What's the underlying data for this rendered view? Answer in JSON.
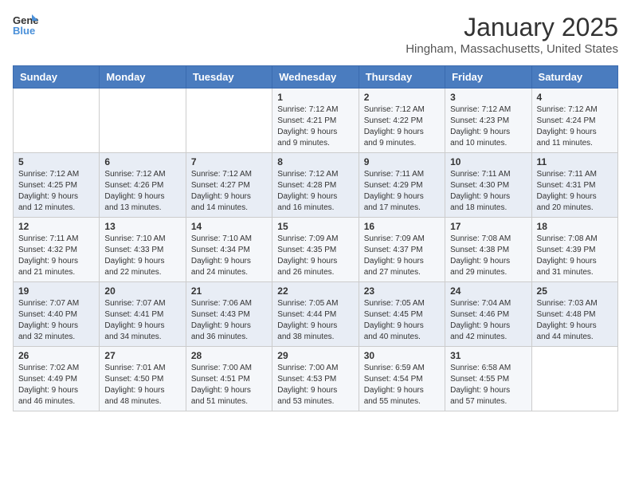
{
  "logo": {
    "general": "General",
    "blue": "Blue"
  },
  "header": {
    "month": "January 2025",
    "location": "Hingham, Massachusetts, United States"
  },
  "weekdays": [
    "Sunday",
    "Monday",
    "Tuesday",
    "Wednesday",
    "Thursday",
    "Friday",
    "Saturday"
  ],
  "weeks": [
    [
      {
        "day": "",
        "info": ""
      },
      {
        "day": "",
        "info": ""
      },
      {
        "day": "",
        "info": ""
      },
      {
        "day": "1",
        "info": "Sunrise: 7:12 AM\nSunset: 4:21 PM\nDaylight: 9 hours\nand 9 minutes."
      },
      {
        "day": "2",
        "info": "Sunrise: 7:12 AM\nSunset: 4:22 PM\nDaylight: 9 hours\nand 9 minutes."
      },
      {
        "day": "3",
        "info": "Sunrise: 7:12 AM\nSunset: 4:23 PM\nDaylight: 9 hours\nand 10 minutes."
      },
      {
        "day": "4",
        "info": "Sunrise: 7:12 AM\nSunset: 4:24 PM\nDaylight: 9 hours\nand 11 minutes."
      }
    ],
    [
      {
        "day": "5",
        "info": "Sunrise: 7:12 AM\nSunset: 4:25 PM\nDaylight: 9 hours\nand 12 minutes."
      },
      {
        "day": "6",
        "info": "Sunrise: 7:12 AM\nSunset: 4:26 PM\nDaylight: 9 hours\nand 13 minutes."
      },
      {
        "day": "7",
        "info": "Sunrise: 7:12 AM\nSunset: 4:27 PM\nDaylight: 9 hours\nand 14 minutes."
      },
      {
        "day": "8",
        "info": "Sunrise: 7:12 AM\nSunset: 4:28 PM\nDaylight: 9 hours\nand 16 minutes."
      },
      {
        "day": "9",
        "info": "Sunrise: 7:11 AM\nSunset: 4:29 PM\nDaylight: 9 hours\nand 17 minutes."
      },
      {
        "day": "10",
        "info": "Sunrise: 7:11 AM\nSunset: 4:30 PM\nDaylight: 9 hours\nand 18 minutes."
      },
      {
        "day": "11",
        "info": "Sunrise: 7:11 AM\nSunset: 4:31 PM\nDaylight: 9 hours\nand 20 minutes."
      }
    ],
    [
      {
        "day": "12",
        "info": "Sunrise: 7:11 AM\nSunset: 4:32 PM\nDaylight: 9 hours\nand 21 minutes."
      },
      {
        "day": "13",
        "info": "Sunrise: 7:10 AM\nSunset: 4:33 PM\nDaylight: 9 hours\nand 22 minutes."
      },
      {
        "day": "14",
        "info": "Sunrise: 7:10 AM\nSunset: 4:34 PM\nDaylight: 9 hours\nand 24 minutes."
      },
      {
        "day": "15",
        "info": "Sunrise: 7:09 AM\nSunset: 4:35 PM\nDaylight: 9 hours\nand 26 minutes."
      },
      {
        "day": "16",
        "info": "Sunrise: 7:09 AM\nSunset: 4:37 PM\nDaylight: 9 hours\nand 27 minutes."
      },
      {
        "day": "17",
        "info": "Sunrise: 7:08 AM\nSunset: 4:38 PM\nDaylight: 9 hours\nand 29 minutes."
      },
      {
        "day": "18",
        "info": "Sunrise: 7:08 AM\nSunset: 4:39 PM\nDaylight: 9 hours\nand 31 minutes."
      }
    ],
    [
      {
        "day": "19",
        "info": "Sunrise: 7:07 AM\nSunset: 4:40 PM\nDaylight: 9 hours\nand 32 minutes."
      },
      {
        "day": "20",
        "info": "Sunrise: 7:07 AM\nSunset: 4:41 PM\nDaylight: 9 hours\nand 34 minutes."
      },
      {
        "day": "21",
        "info": "Sunrise: 7:06 AM\nSunset: 4:43 PM\nDaylight: 9 hours\nand 36 minutes."
      },
      {
        "day": "22",
        "info": "Sunrise: 7:05 AM\nSunset: 4:44 PM\nDaylight: 9 hours\nand 38 minutes."
      },
      {
        "day": "23",
        "info": "Sunrise: 7:05 AM\nSunset: 4:45 PM\nDaylight: 9 hours\nand 40 minutes."
      },
      {
        "day": "24",
        "info": "Sunrise: 7:04 AM\nSunset: 4:46 PM\nDaylight: 9 hours\nand 42 minutes."
      },
      {
        "day": "25",
        "info": "Sunrise: 7:03 AM\nSunset: 4:48 PM\nDaylight: 9 hours\nand 44 minutes."
      }
    ],
    [
      {
        "day": "26",
        "info": "Sunrise: 7:02 AM\nSunset: 4:49 PM\nDaylight: 9 hours\nand 46 minutes."
      },
      {
        "day": "27",
        "info": "Sunrise: 7:01 AM\nSunset: 4:50 PM\nDaylight: 9 hours\nand 48 minutes."
      },
      {
        "day": "28",
        "info": "Sunrise: 7:00 AM\nSunset: 4:51 PM\nDaylight: 9 hours\nand 51 minutes."
      },
      {
        "day": "29",
        "info": "Sunrise: 7:00 AM\nSunset: 4:53 PM\nDaylight: 9 hours\nand 53 minutes."
      },
      {
        "day": "30",
        "info": "Sunrise: 6:59 AM\nSunset: 4:54 PM\nDaylight: 9 hours\nand 55 minutes."
      },
      {
        "day": "31",
        "info": "Sunrise: 6:58 AM\nSunset: 4:55 PM\nDaylight: 9 hours\nand 57 minutes."
      },
      {
        "day": "",
        "info": ""
      }
    ]
  ]
}
